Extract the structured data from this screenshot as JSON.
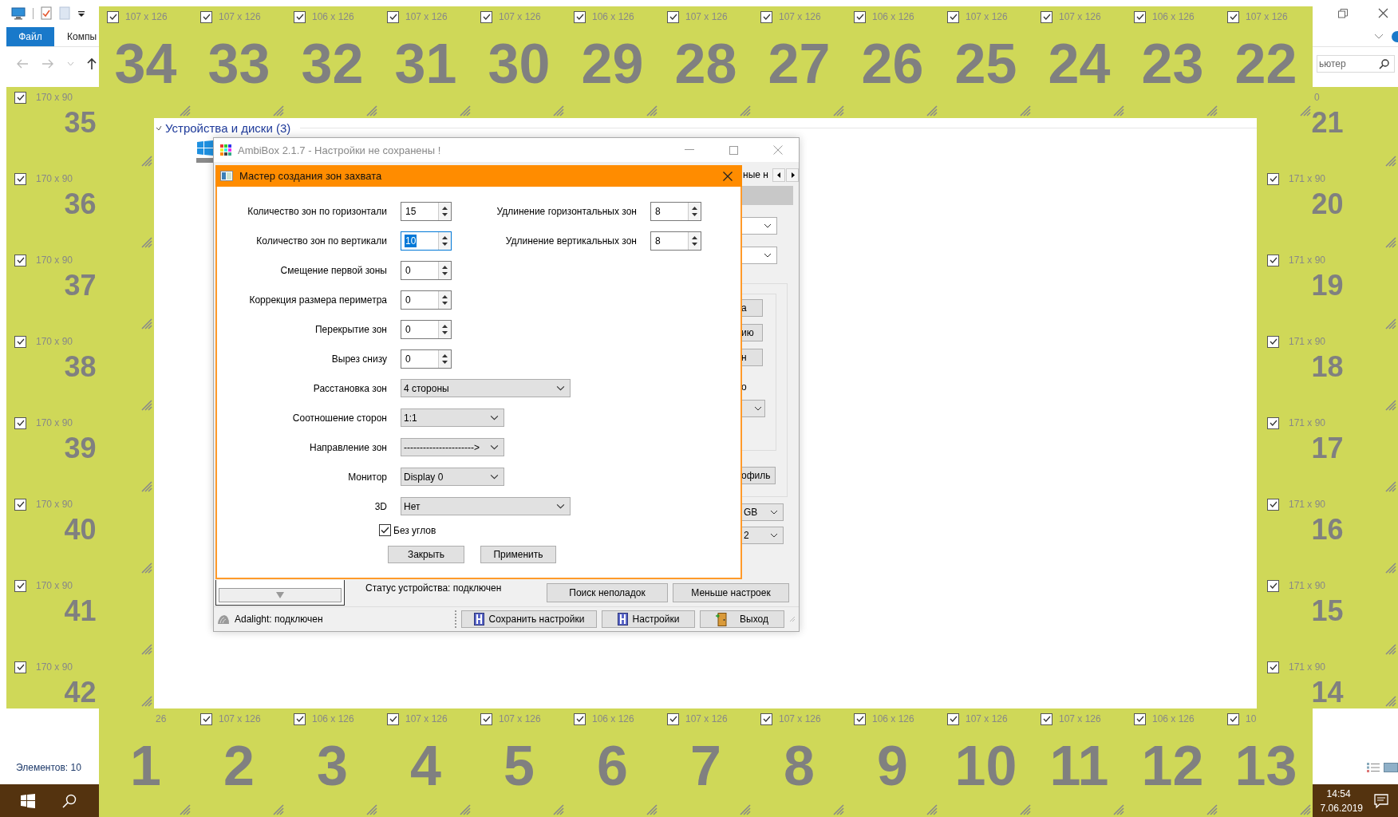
{
  "explorer": {
    "file_tab": "Файл",
    "ribbon_tab": "Компы",
    "search": {
      "placeholder": "ьютер"
    },
    "section": {
      "title": "Устройства и диски (3)",
      "expanded": true
    },
    "status": "Элементов: 10"
  },
  "zones": {
    "top": [
      {
        "number": "34",
        "size": "107 x 126",
        "checked": true
      },
      {
        "number": "33",
        "size": "107 x 126",
        "checked": true
      },
      {
        "number": "32",
        "size": "106 x 126",
        "checked": true
      },
      {
        "number": "31",
        "size": "107 x 126",
        "checked": true
      },
      {
        "number": "30",
        "size": "107 x 126",
        "checked": true
      },
      {
        "number": "29",
        "size": "106 x 126",
        "checked": true
      },
      {
        "number": "28",
        "size": "107 x 126",
        "checked": true
      },
      {
        "number": "27",
        "size": "107 x 126",
        "checked": true
      },
      {
        "number": "26",
        "size": "106 x 126",
        "checked": true
      },
      {
        "number": "25",
        "size": "107 x 126",
        "checked": true
      },
      {
        "number": "24",
        "size": "107 x 126",
        "checked": true
      },
      {
        "number": "23",
        "size": "106 x 126",
        "checked": true
      },
      {
        "number": "22",
        "size": "107 x 126",
        "checked": true
      }
    ],
    "left": [
      {
        "number": "35",
        "size": "170 x 90",
        "checked": true
      },
      {
        "number": "36",
        "size": "170 x 90",
        "checked": true
      },
      {
        "number": "37",
        "size": "170 x 90",
        "checked": true
      },
      {
        "number": "38",
        "size": "170 x 90",
        "checked": true
      },
      {
        "number": "39",
        "size": "170 x 90",
        "checked": true
      },
      {
        "number": "40",
        "size": "170 x 90",
        "checked": true
      },
      {
        "number": "41",
        "size": "170 x 90",
        "checked": true
      },
      {
        "number": "42",
        "size": "170 x 90",
        "checked": true
      }
    ],
    "right": [
      {
        "number": "21",
        "size": "0"
      },
      {
        "number": "20",
        "size": "171 x 90",
        "checked": true
      },
      {
        "number": "19",
        "size": "171 x 90",
        "checked": true
      },
      {
        "number": "18",
        "size": "171 x 90",
        "checked": true
      },
      {
        "number": "17",
        "size": "171 x 90",
        "checked": true
      },
      {
        "number": "16",
        "size": "171 x 90",
        "checked": true
      },
      {
        "number": "15",
        "size": "171 x 90",
        "checked": true
      },
      {
        "number": "14",
        "size": "171 x 90",
        "checked": true
      }
    ],
    "bottom": [
      {
        "number": "1",
        "size": "26"
      },
      {
        "number": "2",
        "size": "107 x 126",
        "checked": true
      },
      {
        "number": "3",
        "size": "106 x 126",
        "checked": true
      },
      {
        "number": "4",
        "size": "107 x 126",
        "checked": true
      },
      {
        "number": "5",
        "size": "107 x 126",
        "checked": true
      },
      {
        "number": "6",
        "size": "106 x 126",
        "checked": true
      },
      {
        "number": "7",
        "size": "107 x 126",
        "checked": true
      },
      {
        "number": "8",
        "size": "107 x 126",
        "checked": true
      },
      {
        "number": "9",
        "size": "106 x 126",
        "checked": true
      },
      {
        "number": "10",
        "size": "107 x 126",
        "checked": true
      },
      {
        "number": "11",
        "size": "107 x 126",
        "checked": true
      },
      {
        "number": "12",
        "size": "106 x 126",
        "checked": true
      },
      {
        "number": "13",
        "size": "10",
        "checked": true
      }
    ]
  },
  "ambibox": {
    "title": "AmbiBox 2.1.7  - Настройки не сохранены !",
    "tab_fragment": "ные н",
    "side_top": [
      {
        "kind": "combo"
      },
      {
        "kind": "combo"
      }
    ],
    "side_group": [
      {
        "kind": "button",
        "label": "а"
      },
      {
        "kind": "button",
        "label": "ию"
      },
      {
        "kind": "button",
        "label": "н"
      },
      {
        "kind": "label",
        "label": "о"
      },
      {
        "kind": "combo"
      }
    ],
    "profile_button": "офиль",
    "side_bottom": [
      {
        "kind": "combo",
        "value": "GB"
      },
      {
        "kind": "combo",
        "value": "2"
      }
    ],
    "device_status": "Статус устройства: подключен",
    "buttons": [
      "Поиск неполадок",
      "Меньше настроек"
    ],
    "connection": "Adalight: подключен",
    "status_buttons": [
      {
        "kind": "save",
        "label": "Сохранить настройки"
      },
      {
        "kind": "settings",
        "label": "Настройки"
      },
      {
        "kind": "exit",
        "label": "Выход"
      }
    ]
  },
  "dialog": {
    "title": "Мастер создания зон захвата",
    "rows": [
      {
        "kind": "spin",
        "label": "Количество зон по горизонтали",
        "value": "15",
        "focused": false
      },
      {
        "kind": "spin",
        "label": "Количество зон по вертикали",
        "value": "10",
        "focused": true
      },
      {
        "kind": "spin",
        "label": "Смещение первой зоны",
        "value": "0",
        "focused": false
      },
      {
        "kind": "spin",
        "label": "Коррекция размера периметра",
        "value": "0",
        "focused": false
      },
      {
        "kind": "spin",
        "label": "Перекрытие зон",
        "value": "0",
        "focused": false
      },
      {
        "kind": "spin",
        "label": "Вырез снизу",
        "value": "0",
        "focused": false
      },
      {
        "kind": "combo-wide",
        "label": "Расстановка зон",
        "value": "4 стороны"
      },
      {
        "kind": "combo",
        "label": "Соотношение сторон",
        "value": "1:1"
      },
      {
        "kind": "combo",
        "label": "Направление зон",
        "value": "---------------------->"
      },
      {
        "kind": "combo",
        "label": "Монитор",
        "value": "Display 0"
      },
      {
        "kind": "combo-wide",
        "label": "3D",
        "value": "Нет"
      }
    ],
    "side_rows": [
      {
        "label": "Удлинение горизонтальных зон",
        "value": "8",
        "focused": false
      },
      {
        "label": "Удлинение вертикальных зон",
        "value": "8",
        "focused": false
      }
    ],
    "checkbox": {
      "label": "Без углов",
      "checked": true
    },
    "buttons": [
      "Закрыть",
      "Применить"
    ]
  },
  "taskbar": {
    "time": "14:54",
    "date": "7.06.2019"
  }
}
